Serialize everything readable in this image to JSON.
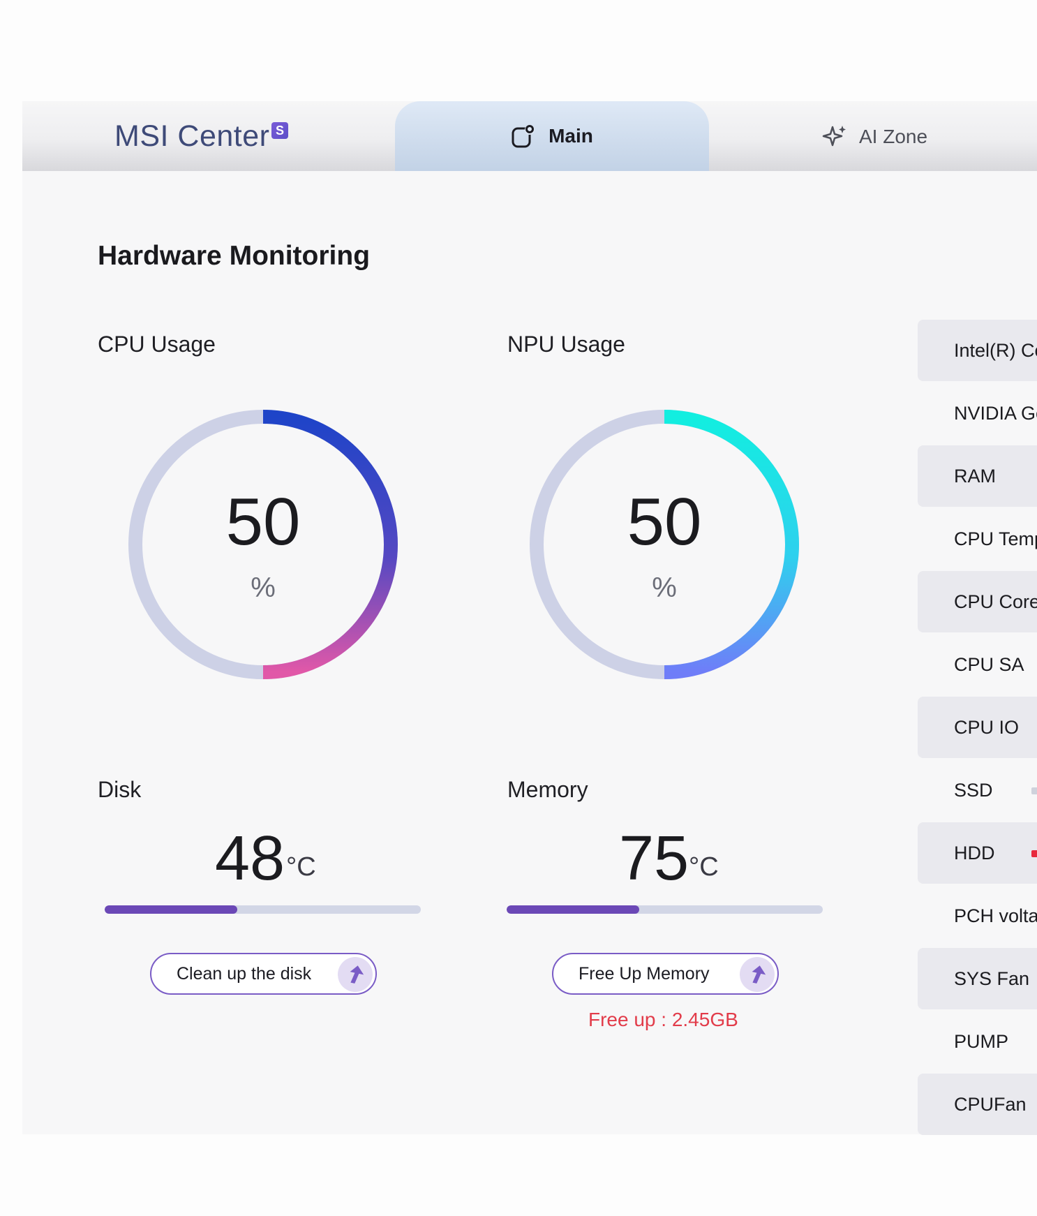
{
  "app": {
    "brand": "MSI Center",
    "brand_badge": "S",
    "tabs": [
      {
        "label": "Main",
        "icon": "main-app-icon",
        "active": true
      },
      {
        "label": "AI Zone",
        "icon": "sparkle-icon",
        "active": false
      }
    ]
  },
  "section_title": "Hardware Monitoring",
  "cpu": {
    "label": "CPU Usage",
    "value": "50",
    "unit": "%",
    "percent": 50,
    "gradient": [
      "#1e44c8",
      "#5548c2",
      "#e158a8"
    ]
  },
  "npu": {
    "label": "NPU Usage",
    "value": "50",
    "unit": "%",
    "percent": 50,
    "gradient": [
      "#12eee0",
      "#2fd0ee",
      "#6f7df8"
    ]
  },
  "disk": {
    "label": "Disk",
    "value": "48",
    "unit": "°C",
    "fill_percent": 42,
    "button": "Clean up the disk"
  },
  "memory": {
    "label": "Memory",
    "value": "75",
    "unit": "°C",
    "fill_percent": 42,
    "button": "Free Up Memory",
    "note": "Free up : 2.45GB"
  },
  "sidebar": [
    {
      "label": "Intel(R) Core",
      "shaded": true
    },
    {
      "label": "NVIDIA GeForce",
      "shaded": false
    },
    {
      "label": "RAM",
      "shaded": true
    },
    {
      "label": "CPU Temperature",
      "shaded": false
    },
    {
      "label": "CPU Core",
      "shaded": true
    },
    {
      "label": "CPU SA",
      "shaded": false
    },
    {
      "label": "CPU IO",
      "shaded": true
    },
    {
      "label": "SSD",
      "shaded": false,
      "indicator": "#cfd2dc"
    },
    {
      "label": "HDD",
      "shaded": true,
      "indicator": "#e8283c"
    },
    {
      "label": "PCH voltage",
      "shaded": false
    },
    {
      "label": "SYS Fan",
      "shaded": true
    },
    {
      "label": "PUMP",
      "shaded": false
    },
    {
      "label": "CPUFan",
      "shaded": true
    }
  ],
  "colors": {
    "accent": "#6b48b6",
    "track": "#cdd1e6",
    "warning": "#e23c4a"
  }
}
